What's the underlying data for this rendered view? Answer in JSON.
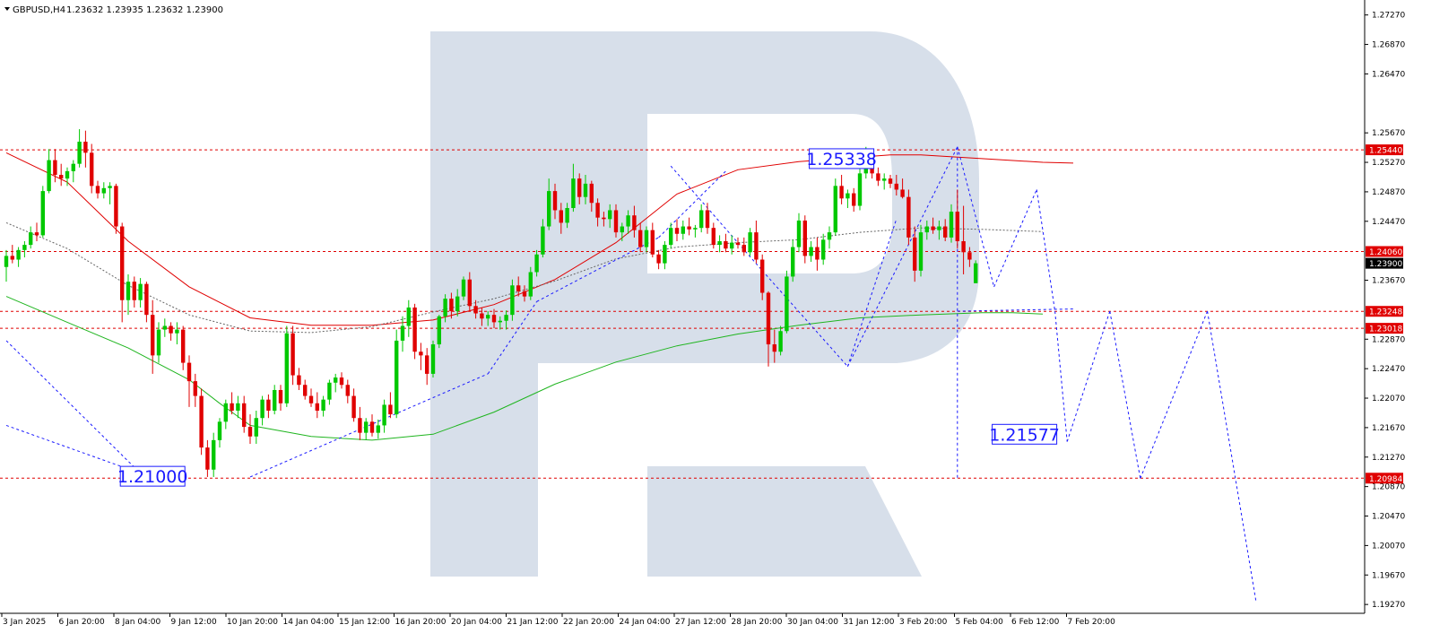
{
  "header": {
    "symbol": "GBPUSD,H4",
    "ohlc": "1.23632 1.23935 1.23632 1.23900"
  },
  "colors": {
    "bull": "#00c800",
    "bear": "#e00000",
    "level": "#e00000",
    "forecast": "#1a1aff",
    "ma_slow": "#e00000",
    "ma_fast": "#1fb51f",
    "ma_mid": "#666666",
    "watermark": "#d7dfea",
    "price_tag": "#e00000",
    "current_tag": "#000000"
  },
  "chart_data": {
    "type": "candlestick",
    "title": "GBPUSD,H4",
    "ylim": [
      1.1915,
      1.274
    ],
    "grid": false,
    "y_ticks": [
      "1.27270",
      "1.26870",
      "1.26470",
      "1.25670",
      "1.25270",
      "1.24870",
      "1.24470",
      "1.23670",
      "1.22870",
      "1.22470",
      "1.22070",
      "1.21670",
      "1.21270",
      "1.20870",
      "1.20470",
      "1.20070",
      "1.19670",
      "1.19270"
    ],
    "x_ticks": [
      "3 Jan 2025",
      "6 Jan 20:00",
      "8 Jan 04:00",
      "9 Jan 12:00",
      "10 Jan 20:00",
      "14 Jan 04:00",
      "15 Jan 12:00",
      "16 Jan 20:00",
      "20 Jan 04:00",
      "21 Jan 12:00",
      "22 Jan 20:00",
      "24 Jan 04:00",
      "27 Jan 12:00",
      "28 Jan 20:00",
      "30 Jan 04:00",
      "31 Jan 12:00",
      "3 Feb 20:00",
      "5 Feb 04:00",
      "6 Feb 12:00",
      "7 Feb 20:00"
    ],
    "levels": [
      {
        "value": 1.2544,
        "label": "1.25440"
      },
      {
        "value": 1.2406,
        "label": "1.24060"
      },
      {
        "value": 1.23248,
        "label": "1.23248"
      },
      {
        "value": 1.23018,
        "label": "1.23018"
      },
      {
        "value": 1.20984,
        "label": "1.20984"
      }
    ],
    "current_price": {
      "value": 1.239,
      "label": "1.23900"
    },
    "annotations": [
      {
        "text": "1.25338",
        "value": 1.2532,
        "bar": 137
      },
      {
        "text": "1.21000",
        "value": 1.2101,
        "bar": 24
      },
      {
        "text": "1.21577",
        "value": 1.2158,
        "bar": 167
      }
    ],
    "candles": [
      [
        1.2385,
        1.2408,
        1.2365,
        1.24
      ],
      [
        1.24,
        1.2415,
        1.239,
        1.2395
      ],
      [
        1.2395,
        1.2412,
        1.2385,
        1.2408
      ],
      [
        1.2408,
        1.242,
        1.2398,
        1.2415
      ],
      [
        1.2415,
        1.244,
        1.241,
        1.2432
      ],
      [
        1.2432,
        1.2445,
        1.242,
        1.2428
      ],
      [
        1.2428,
        1.2495,
        1.2425,
        1.2488
      ],
      [
        1.2488,
        1.2545,
        1.2485,
        1.253
      ],
      [
        1.253,
        1.2545,
        1.25,
        1.251
      ],
      [
        1.251,
        1.2525,
        1.2495,
        1.2505
      ],
      [
        1.2505,
        1.252,
        1.2495,
        1.2515
      ],
      [
        1.2515,
        1.253,
        1.25,
        1.2525
      ],
      [
        1.2525,
        1.2572,
        1.252,
        1.2555
      ],
      [
        1.2555,
        1.257,
        1.252,
        1.254
      ],
      [
        1.254,
        1.2552,
        1.2485,
        1.2495
      ],
      [
        1.2495,
        1.2502,
        1.2478,
        1.2485
      ],
      [
        1.2485,
        1.25,
        1.2478,
        1.2492
      ],
      [
        1.2492,
        1.25,
        1.247,
        1.2495
      ],
      [
        1.2495,
        1.2498,
        1.243,
        1.244
      ],
      [
        1.244,
        1.2445,
        1.231,
        1.234
      ],
      [
        1.234,
        1.2375,
        1.232,
        1.2365
      ],
      [
        1.2365,
        1.2372,
        1.233,
        1.234
      ],
      [
        1.234,
        1.237,
        1.233,
        1.2362
      ],
      [
        1.2362,
        1.2365,
        1.231,
        1.232
      ],
      [
        1.232,
        1.234,
        1.224,
        1.2265
      ],
      [
        1.2265,
        1.231,
        1.2255,
        1.23
      ],
      [
        1.23,
        1.2315,
        1.229,
        1.2305
      ],
      [
        1.2305,
        1.231,
        1.2285,
        1.2295
      ],
      [
        1.2295,
        1.231,
        1.228,
        1.23
      ],
      [
        1.23,
        1.2305,
        1.2245,
        1.2255
      ],
      [
        1.2255,
        1.2265,
        1.2195,
        1.223
      ],
      [
        1.223,
        1.224,
        1.2195,
        1.221
      ],
      [
        1.221,
        1.222,
        1.213,
        1.214
      ],
      [
        1.214,
        1.215,
        1.21,
        1.211
      ],
      [
        1.211,
        1.216,
        1.21,
        1.215
      ],
      [
        1.215,
        1.218,
        1.214,
        1.2175
      ],
      [
        1.2175,
        1.2205,
        1.2165,
        1.22
      ],
      [
        1.22,
        1.2215,
        1.2185,
        1.219
      ],
      [
        1.219,
        1.221,
        1.218,
        1.22
      ],
      [
        1.22,
        1.221,
        1.216,
        1.2168
      ],
      [
        1.2168,
        1.2185,
        1.2145,
        1.2155
      ],
      [
        1.2155,
        1.219,
        1.2145,
        1.218
      ],
      [
        1.218,
        1.221,
        1.217,
        1.2205
      ],
      [
        1.2205,
        1.2212,
        1.218,
        1.219
      ],
      [
        1.219,
        1.2225,
        1.2185,
        1.2218
      ],
      [
        1.2218,
        1.2225,
        1.219,
        1.22
      ],
      [
        1.22,
        1.2305,
        1.2195,
        1.2295
      ],
      [
        1.2295,
        1.2305,
        1.2225,
        1.2238
      ],
      [
        1.2238,
        1.2248,
        1.2218,
        1.2225
      ],
      [
        1.2225,
        1.2232,
        1.2205,
        1.221
      ],
      [
        1.221,
        1.222,
        1.2195,
        1.22
      ],
      [
        1.22,
        1.2215,
        1.218,
        1.219
      ],
      [
        1.219,
        1.221,
        1.2182,
        1.2205
      ],
      [
        1.2205,
        1.2232,
        1.2198,
        1.2228
      ],
      [
        1.2228,
        1.224,
        1.2215,
        1.2235
      ],
      [
        1.2235,
        1.2242,
        1.222,
        1.2225
      ],
      [
        1.2225,
        1.2232,
        1.22,
        1.221
      ],
      [
        1.221,
        1.222,
        1.2175,
        1.218
      ],
      [
        1.218,
        1.2195,
        1.215,
        1.216
      ],
      [
        1.216,
        1.218,
        1.215,
        1.2175
      ],
      [
        1.2175,
        1.2185,
        1.2155,
        1.216
      ],
      [
        1.216,
        1.2178,
        1.2152,
        1.217
      ],
      [
        1.217,
        1.2205,
        1.216,
        1.2198
      ],
      [
        1.2198,
        1.2215,
        1.218,
        1.2185
      ],
      [
        1.2185,
        1.23,
        1.218,
        1.2285
      ],
      [
        1.2285,
        1.2318,
        1.227,
        1.2305
      ],
      [
        1.2305,
        1.234,
        1.229,
        1.233
      ],
      [
        1.233,
        1.2335,
        1.226,
        1.227
      ],
      [
        1.227,
        1.2282,
        1.2245,
        1.2265
      ],
      [
        1.2265,
        1.2275,
        1.2225,
        1.224
      ],
      [
        1.224,
        1.2285,
        1.2235,
        1.228
      ],
      [
        1.228,
        1.232,
        1.2275,
        1.2318
      ],
      [
        1.2318,
        1.2348,
        1.231,
        1.2342
      ],
      [
        1.2342,
        1.235,
        1.2315,
        1.2325
      ],
      [
        1.2325,
        1.2355,
        1.2318,
        1.2345
      ],
      [
        1.2345,
        1.2372,
        1.234,
        1.2368
      ],
      [
        1.2368,
        1.2378,
        1.2325,
        1.2332
      ],
      [
        1.2332,
        1.234,
        1.2315,
        1.2322
      ],
      [
        1.2322,
        1.233,
        1.2305,
        1.2315
      ],
      [
        1.2315,
        1.2325,
        1.2305,
        1.232
      ],
      [
        1.232,
        1.2328,
        1.2302,
        1.231
      ],
      [
        1.231,
        1.2318,
        1.23,
        1.2312
      ],
      [
        1.2312,
        1.2326,
        1.23,
        1.232
      ],
      [
        1.232,
        1.2368,
        1.2312,
        1.236
      ],
      [
        1.236,
        1.2372,
        1.2345,
        1.2352
      ],
      [
        1.2352,
        1.236,
        1.2338,
        1.2345
      ],
      [
        1.2345,
        1.2385,
        1.234,
        1.2378
      ],
      [
        1.2378,
        1.2408,
        1.2372,
        1.2402
      ],
      [
        1.2402,
        1.245,
        1.2398,
        1.244
      ],
      [
        1.244,
        1.2505,
        1.2435,
        1.2488
      ],
      [
        1.2488,
        1.2498,
        1.245,
        1.2462
      ],
      [
        1.2462,
        1.2472,
        1.243,
        1.2445
      ],
      [
        1.2445,
        1.2472,
        1.2438,
        1.2465
      ],
      [
        1.2465,
        1.2525,
        1.246,
        1.2505
      ],
      [
        1.2505,
        1.2512,
        1.247,
        1.248
      ],
      [
        1.248,
        1.251,
        1.247,
        1.2498
      ],
      [
        1.2498,
        1.2502,
        1.246,
        1.2472
      ],
      [
        1.2472,
        1.2478,
        1.244,
        1.2452
      ],
      [
        1.2452,
        1.246,
        1.244,
        1.245
      ],
      [
        1.245,
        1.247,
        1.2438,
        1.2462
      ],
      [
        1.2462,
        1.247,
        1.2425,
        1.2432
      ],
      [
        1.2432,
        1.2445,
        1.242,
        1.244
      ],
      [
        1.244,
        1.2462,
        1.243,
        1.2455
      ],
      [
        1.2455,
        1.2468,
        1.2425,
        1.2435
      ],
      [
        1.2435,
        1.2445,
        1.2405,
        1.2412
      ],
      [
        1.2412,
        1.244,
        1.2405,
        1.2435
      ],
      [
        1.2435,
        1.2445,
        1.2398,
        1.2402
      ],
      [
        1.2402,
        1.2408,
        1.2382,
        1.239
      ],
      [
        1.239,
        1.242,
        1.2382,
        1.2415
      ],
      [
        1.2415,
        1.2445,
        1.241,
        1.2438
      ],
      [
        1.2438,
        1.245,
        1.242,
        1.243
      ],
      [
        1.243,
        1.2448,
        1.2422,
        1.244
      ],
      [
        1.244,
        1.2452,
        1.2428,
        1.2436
      ],
      [
        1.2436,
        1.2442,
        1.2425,
        1.2438
      ],
      [
        1.2438,
        1.247,
        1.2432,
        1.2462
      ],
      [
        1.2462,
        1.2472,
        1.243,
        1.2438
      ],
      [
        1.2438,
        1.2445,
        1.241,
        1.2415
      ],
      [
        1.2415,
        1.2428,
        1.2405,
        1.242
      ],
      [
        1.242,
        1.243,
        1.2405,
        1.241
      ],
      [
        1.241,
        1.2428,
        1.2402,
        1.2418
      ],
      [
        1.2418,
        1.2425,
        1.241,
        1.2415
      ],
      [
        1.2415,
        1.2425,
        1.24,
        1.2405
      ],
      [
        1.2405,
        1.2438,
        1.24,
        1.2432
      ],
      [
        1.2432,
        1.2448,
        1.239,
        1.2395
      ],
      [
        1.2395,
        1.2402,
        1.234,
        1.235
      ],
      [
        1.235,
        1.2352,
        1.225,
        1.228
      ],
      [
        1.228,
        1.23,
        1.2255,
        1.227
      ],
      [
        1.227,
        1.2305,
        1.2265,
        1.2298
      ],
      [
        1.2298,
        1.238,
        1.2295,
        1.2372
      ],
      [
        1.2372,
        1.2422,
        1.2365,
        1.2412
      ],
      [
        1.2412,
        1.2458,
        1.2405,
        1.2448
      ],
      [
        1.2448,
        1.2455,
        1.239,
        1.24
      ],
      [
        1.24,
        1.242,
        1.2392,
        1.2412
      ],
      [
        1.2412,
        1.2425,
        1.238,
        1.2395
      ],
      [
        1.2395,
        1.243,
        1.2388,
        1.2422
      ],
      [
        1.2422,
        1.244,
        1.241,
        1.2432
      ],
      [
        1.2432,
        1.2505,
        1.2428,
        1.2495
      ],
      [
        1.2495,
        1.251,
        1.247,
        1.2478
      ],
      [
        1.2478,
        1.249,
        1.2465,
        1.2485
      ],
      [
        1.2485,
        1.2492,
        1.246,
        1.2468
      ],
      [
        1.2468,
        1.252,
        1.2462,
        1.2512
      ],
      [
        1.2512,
        1.2548,
        1.2505,
        1.2532
      ],
      [
        1.2532,
        1.254,
        1.2505,
        1.2512
      ],
      [
        1.2512,
        1.252,
        1.2495,
        1.2502
      ],
      [
        1.2502,
        1.2512,
        1.249,
        1.2505
      ],
      [
        1.2505,
        1.251,
        1.2492,
        1.2498
      ],
      [
        1.2498,
        1.251,
        1.2482,
        1.249
      ],
      [
        1.249,
        1.2505,
        1.2478,
        1.248
      ],
      [
        1.248,
        1.249,
        1.2415,
        1.2425
      ],
      [
        1.2425,
        1.244,
        1.2365,
        1.238
      ],
      [
        1.238,
        1.2442,
        1.2372,
        1.2432
      ],
      [
        1.2432,
        1.2448,
        1.2422,
        1.244
      ],
      [
        1.244,
        1.2452,
        1.243,
        1.2435
      ],
      [
        1.2435,
        1.2448,
        1.2422,
        1.244
      ],
      [
        1.244,
        1.245,
        1.242,
        1.2425
      ],
      [
        1.2425,
        1.247,
        1.2418,
        1.246
      ],
      [
        1.246,
        1.249,
        1.241,
        1.242
      ],
      [
        1.242,
        1.2468,
        1.2375,
        1.2405
      ],
      [
        1.2405,
        1.2412,
        1.2385,
        1.2395
      ],
      [
        1.2363,
        1.2394,
        1.2363,
        1.239
      ]
    ],
    "ma_slow": [
      [
        0,
        1.254
      ],
      [
        10,
        1.25
      ],
      [
        20,
        1.242
      ],
      [
        30,
        1.2358
      ],
      [
        40,
        1.2316
      ],
      [
        50,
        1.2306
      ],
      [
        60,
        1.2306
      ],
      [
        70,
        1.2313
      ],
      [
        80,
        1.2334
      ],
      [
        90,
        1.2368
      ],
      [
        100,
        1.2418
      ],
      [
        110,
        1.2484
      ],
      [
        120,
        1.2517
      ],
      [
        130,
        1.2528
      ],
      [
        140,
        1.2534
      ],
      [
        145,
        1.2537
      ],
      [
        150,
        1.2537
      ],
      [
        160,
        1.2532
      ],
      [
        170,
        1.2527
      ],
      [
        175,
        1.2526
      ]
    ],
    "ma_fast": [
      [
        0,
        1.2345
      ],
      [
        10,
        1.231
      ],
      [
        20,
        1.2275
      ],
      [
        30,
        1.2232
      ],
      [
        35,
        1.22
      ],
      [
        40,
        1.217
      ],
      [
        50,
        1.2155
      ],
      [
        60,
        1.215
      ],
      [
        70,
        1.2158
      ],
      [
        80,
        1.2188
      ],
      [
        90,
        1.2226
      ],
      [
        100,
        1.2256
      ],
      [
        110,
        1.2278
      ],
      [
        120,
        1.2294
      ],
      [
        130,
        1.2306
      ],
      [
        140,
        1.2316
      ],
      [
        150,
        1.232
      ],
      [
        160,
        1.2323
      ],
      [
        165,
        1.2323
      ],
      [
        170,
        1.2321
      ]
    ],
    "ma_mid": [
      [
        0,
        1.2445
      ],
      [
        10,
        1.241
      ],
      [
        20,
        1.236
      ],
      [
        30,
        1.232
      ],
      [
        40,
        1.2298
      ],
      [
        50,
        1.2296
      ],
      [
        60,
        1.2304
      ],
      [
        70,
        1.2324
      ],
      [
        80,
        1.2342
      ],
      [
        90,
        1.2366
      ],
      [
        100,
        1.2396
      ],
      [
        110,
        1.2412
      ],
      [
        120,
        1.2418
      ],
      [
        130,
        1.2422
      ],
      [
        140,
        1.2432
      ],
      [
        150,
        1.2438
      ],
      [
        160,
        1.2436
      ],
      [
        170,
        1.2433
      ]
    ],
    "forecast_segments": [
      [
        [
          0,
          1.2285
        ],
        [
          22,
          1.2105
        ]
      ],
      [
        [
          0,
          1.217
        ],
        [
          22,
          1.2105
        ]
      ],
      [
        [
          40,
          1.21
        ],
        [
          79,
          1.224
        ]
      ],
      [
        [
          79,
          1.224
        ],
        [
          87,
          1.2338
        ]
      ],
      [
        [
          87,
          1.2338
        ],
        [
          107,
          1.2425
        ]
      ],
      [
        [
          107,
          1.2425
        ],
        [
          118,
          1.2515
        ]
      ],
      [
        [
          109,
          1.2522
        ],
        [
          124,
          1.238
        ]
      ],
      [
        [
          124,
          1.238
        ],
        [
          138,
          1.225
        ]
      ],
      [
        [
          138,
          1.225
        ],
        [
          146,
          1.245
        ]
      ],
      [
        [
          138,
          1.225
        ],
        [
          156,
          1.2548
        ]
      ],
      [
        [
          156,
          1.2548
        ],
        [
          162,
          1.2358
        ]
      ],
      [
        [
          162,
          1.2358
        ],
        [
          169,
          1.249
        ]
      ],
      [
        [
          169,
          1.249
        ],
        [
          172,
          1.2325
        ]
      ],
      [
        [
          156,
          1.2325
        ],
        [
          175,
          1.2328
        ]
      ],
      [
        [
          172,
          1.2325
        ],
        [
          174,
          1.2148
        ]
      ],
      [
        [
          174,
          1.2148
        ],
        [
          181,
          1.2325
        ]
      ],
      [
        [
          181,
          1.2325
        ],
        [
          186,
          1.2098
        ]
      ],
      [
        [
          186,
          1.2098
        ],
        [
          197,
          1.2325
        ]
      ],
      [
        [
          197,
          1.2325
        ],
        [
          205,
          1.193
        ]
      ],
      [
        [
          156,
          1.2548
        ],
        [
          156,
          1.2098
        ]
      ]
    ]
  }
}
